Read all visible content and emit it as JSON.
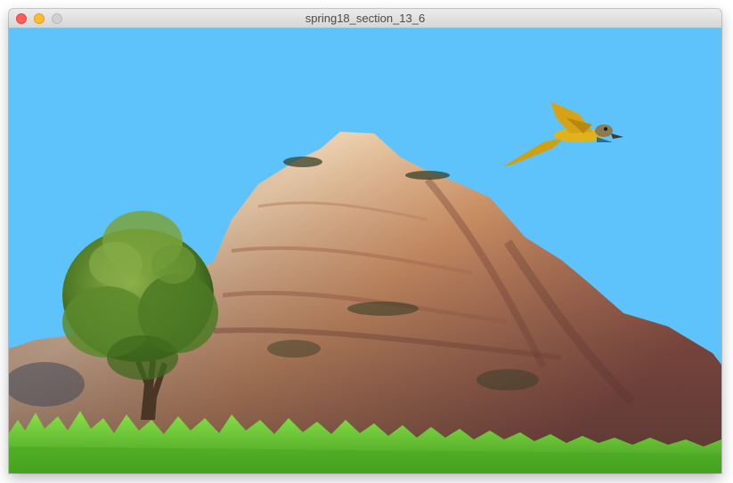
{
  "window": {
    "title": "spring18_section_13_6"
  },
  "scene": {
    "sky_color": "#5fc3fb",
    "elements": [
      "sky",
      "mountain",
      "tree",
      "parrot",
      "grass"
    ]
  },
  "colors": {
    "rock_light": "#e3c29a",
    "rock_mid": "#c58a62",
    "rock_dark": "#7a4a3a",
    "foliage": "#5f8a2e",
    "grass": "#5cc02a",
    "parrot": "#d9a81a"
  }
}
